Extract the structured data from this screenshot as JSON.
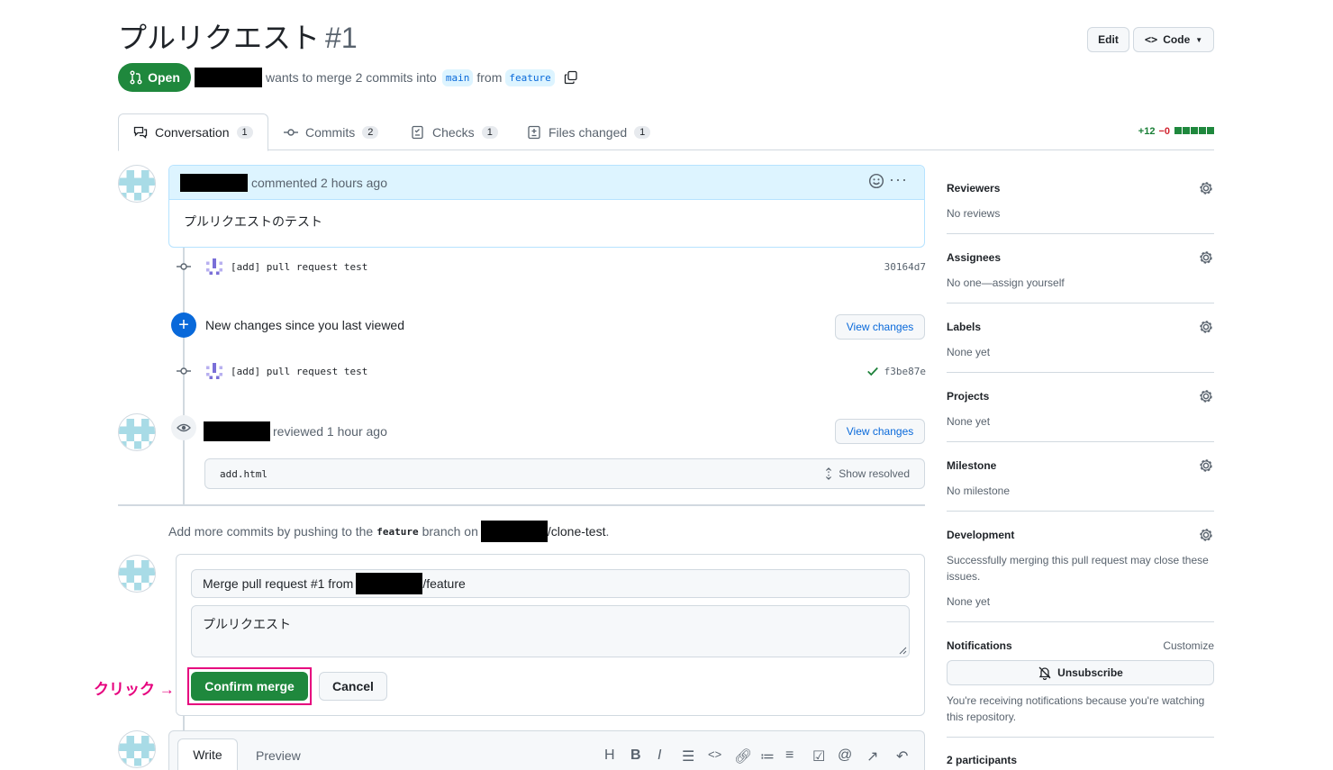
{
  "header": {
    "title": "プルリクエスト",
    "number": "#1",
    "edit_label": "Edit",
    "code_label": "Code",
    "state_label": "Open",
    "meta_text": "wants to merge 2 commits into",
    "base_branch": "main",
    "from_text": "from",
    "head_branch": "feature"
  },
  "tabs": [
    {
      "label": "Conversation",
      "count": "1"
    },
    {
      "label": "Commits",
      "count": "2"
    },
    {
      "label": "Checks",
      "count": "1"
    },
    {
      "label": "Files changed",
      "count": "1"
    }
  ],
  "diffstat": {
    "additions": "+12",
    "deletions": "−0"
  },
  "comment": {
    "meta": "commented 2 hours ago",
    "body": "プルリクエストのテスト"
  },
  "commits": [
    {
      "message": "[add] pull request test",
      "sha": "30164d7"
    },
    {
      "message": "[add] pull request test",
      "sha": "f3be87e"
    }
  ],
  "new_changes": {
    "text": "New changes since you last viewed",
    "button": "View changes"
  },
  "review": {
    "meta": "reviewed 1 hour ago",
    "button": "View changes",
    "file": "add.html",
    "show_resolved": "Show resolved"
  },
  "push_hint": {
    "prefix": "Add more commits by pushing to the",
    "branch": "feature",
    "middle": "branch on",
    "repo": "/clone-test",
    "suffix": "."
  },
  "merge": {
    "title_prefix": "Merge pull request #1 from",
    "title_suffix": "/feature",
    "description": "プルリクエスト",
    "confirm_label": "Confirm merge",
    "cancel_label": "Cancel"
  },
  "annotation": {
    "text": "クリック →",
    "color": "#e6007e"
  },
  "editor": {
    "write_tab": "Write",
    "preview_tab": "Preview"
  },
  "sidebar": {
    "reviewers": {
      "title": "Reviewers",
      "value": "No reviews"
    },
    "assignees": {
      "title": "Assignees",
      "value": "No one—assign yourself"
    },
    "labels": {
      "title": "Labels",
      "value": "None yet"
    },
    "projects": {
      "title": "Projects",
      "value": "None yet"
    },
    "milestone": {
      "title": "Milestone",
      "value": "No milestone"
    },
    "development": {
      "title": "Development",
      "desc": "Successfully merging this pull request may close these issues.",
      "value": "None yet"
    },
    "notifications": {
      "title": "Notifications",
      "customize": "Customize",
      "button": "Unsubscribe",
      "desc": "You're receiving notifications because you're watching this repository."
    },
    "participants": "2 participants"
  },
  "colors": {
    "primary_green": "#1f883d",
    "link_blue": "#0969da",
    "highlight_pink": "#e6007e"
  }
}
